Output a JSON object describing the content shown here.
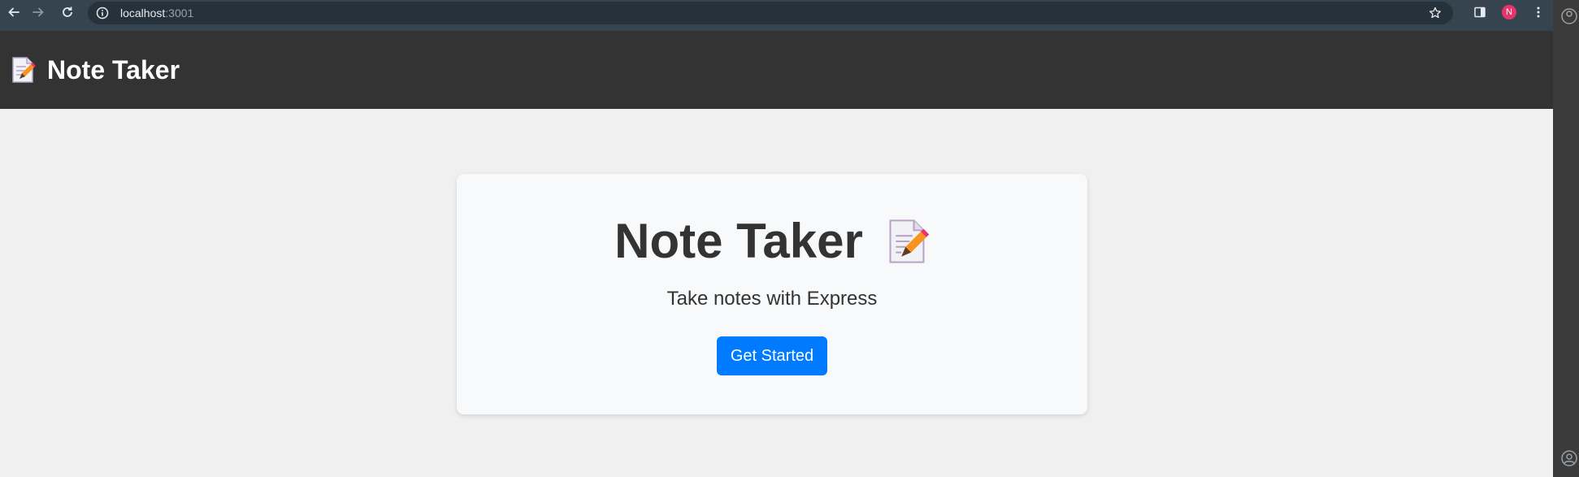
{
  "browser": {
    "url_host": "localhost",
    "url_port": ":3001",
    "profile_initial": "N",
    "icons": {
      "back": "arrow-left-icon",
      "forward": "arrow-right-icon",
      "reload": "reload-icon",
      "site_info": "info-circle-icon",
      "bookmark": "star-icon",
      "side_panel": "side-panel-icon",
      "menu": "kebab-menu-icon"
    }
  },
  "header": {
    "logo_icon": "memo-icon",
    "title": "Note Taker"
  },
  "hero": {
    "title": "Note Taker",
    "title_icon": "memo-icon",
    "subtitle": "Take notes with Express",
    "button_label": "Get Started"
  },
  "colors": {
    "header_bg": "#333333",
    "page_bg": "#f0f0f0",
    "card_bg": "#f8f9fa",
    "button_bg": "#007bff",
    "avatar_bg": "#e8336b"
  }
}
